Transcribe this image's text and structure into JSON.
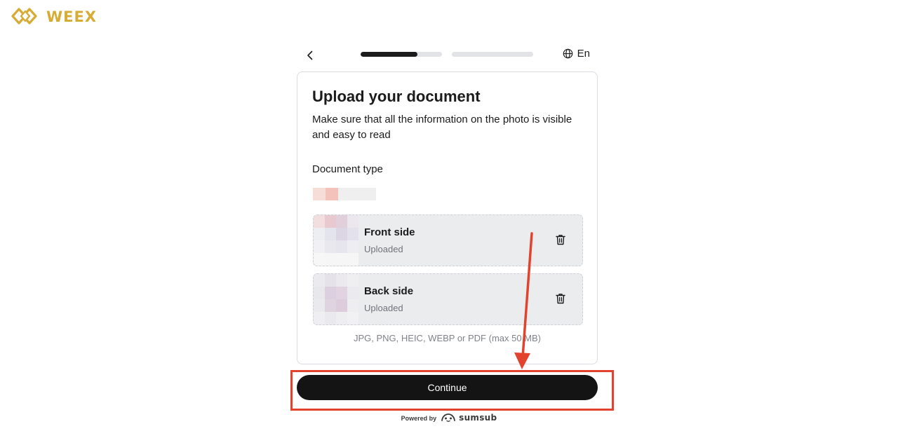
{
  "brand": {
    "name": "WEEX",
    "color": "#d6ac35"
  },
  "topbar": {
    "back_icon": "chevron-left-icon",
    "steps": [
      {
        "progress": 0.7
      },
      {
        "progress": 0
      }
    ],
    "language": "En",
    "language_icon": "globe-icon"
  },
  "card": {
    "title": "Upload your document",
    "subtitle": "Make sure that all the information on the photo is visible and easy to read",
    "document_type_label": "Document type",
    "uploads": [
      {
        "title": "Front side",
        "status": "Uploaded",
        "action_icon": "trash-icon"
      },
      {
        "title": "Back side",
        "status": "Uploaded",
        "action_icon": "trash-icon"
      }
    ],
    "formats_note": "JPG, PNG, HEIC, WEBP or PDF (max 50 MB)"
  },
  "continue_label": "Continue",
  "footer": {
    "powered_by": "Powered by",
    "provider": "sumsub"
  },
  "colors": {
    "primary_button": "#141414",
    "annotation": "#e2432e",
    "progress_active": "#1b1b1b",
    "progress_track": "#e2e3e7"
  }
}
